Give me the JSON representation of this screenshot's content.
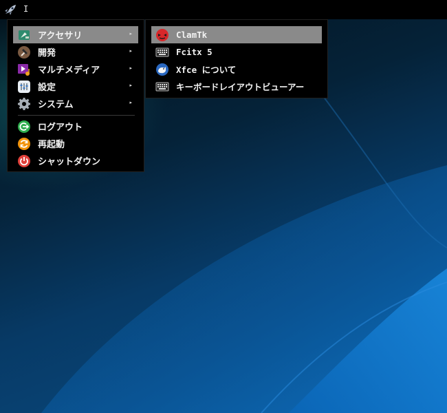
{
  "panel": {
    "launcher_icon": "rocket-icon",
    "cursor_text": "I"
  },
  "main_menu": {
    "items": [
      {
        "label": "アクセサリ",
        "icon": "accessories-icon",
        "has_submenu": true
      },
      {
        "label": "開発",
        "icon": "hammer-icon",
        "has_submenu": true
      },
      {
        "label": "マルチメディア",
        "icon": "multimedia-icon",
        "has_submenu": true
      },
      {
        "label": "設定",
        "icon": "settings-icon",
        "has_submenu": true
      },
      {
        "label": "システム",
        "icon": "gear-icon",
        "has_submenu": true
      }
    ],
    "actions": [
      {
        "label": "ログアウト",
        "icon": "logout-icon"
      },
      {
        "label": "再起動",
        "icon": "restart-icon"
      },
      {
        "label": "シャットダウン",
        "icon": "power-icon"
      }
    ],
    "submenu_arrow": "▸"
  },
  "sub_menu": {
    "items": [
      {
        "label": "ClamTk",
        "icon": "clamtk-icon"
      },
      {
        "label": "Fcitx 5",
        "icon": "keyboard-icon"
      },
      {
        "label": "Xfce について",
        "icon": "xfce-icon"
      },
      {
        "label": "キーボードレイアウトビューアー",
        "icon": "keyboard-icon"
      }
    ]
  },
  "colors": {
    "menu_background": "#000000",
    "highlight": "#8a8a8a",
    "text": "#f2f2f2"
  }
}
